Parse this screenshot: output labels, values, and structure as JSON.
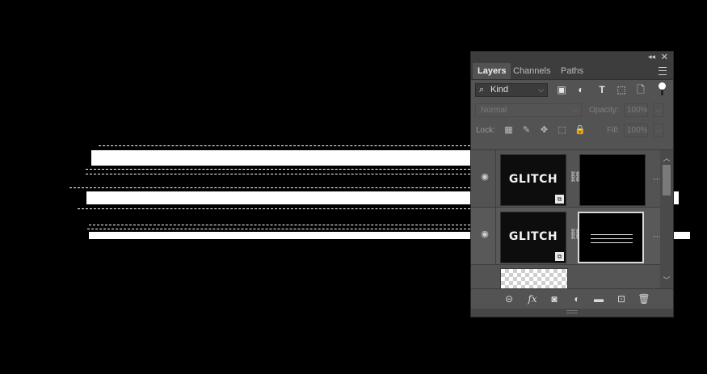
{
  "panel": {
    "collapse_glyph": "◂◂",
    "close_glyph": "✕",
    "tabs": [
      {
        "label": "Layers",
        "active": true
      },
      {
        "label": "Channels",
        "active": false
      },
      {
        "label": "Paths",
        "active": false
      }
    ],
    "filter": {
      "kind_label": "Kind",
      "icons": [
        "image-filter-icon",
        "adjustment-filter-icon",
        "type-filter-icon",
        "shape-filter-icon",
        "smart-object-filter-icon",
        "filter-toggle-icon"
      ]
    },
    "blend": {
      "mode": "Normal",
      "opacity_label": "Opacity:",
      "opacity_value": "100%"
    },
    "lock": {
      "label": "Lock:",
      "fill_label": "Fill:",
      "fill_value": "100%"
    },
    "layers": [
      {
        "thumb_text": "GLITCH",
        "has_mask": true,
        "mask_lines": 0,
        "selected": false
      },
      {
        "thumb_text": "GLITCH",
        "has_mask": true,
        "mask_lines": 3,
        "selected": true
      },
      {
        "thumb_text": "",
        "transparent": true
      }
    ],
    "bottom_icons": [
      "link-layers-icon",
      "fx-icon",
      "add-mask-icon",
      "new-adjustment-icon",
      "new-group-icon",
      "new-layer-icon",
      "delete-layer-icon"
    ],
    "labels": {
      "more": "···",
      "fx": "fx"
    }
  }
}
